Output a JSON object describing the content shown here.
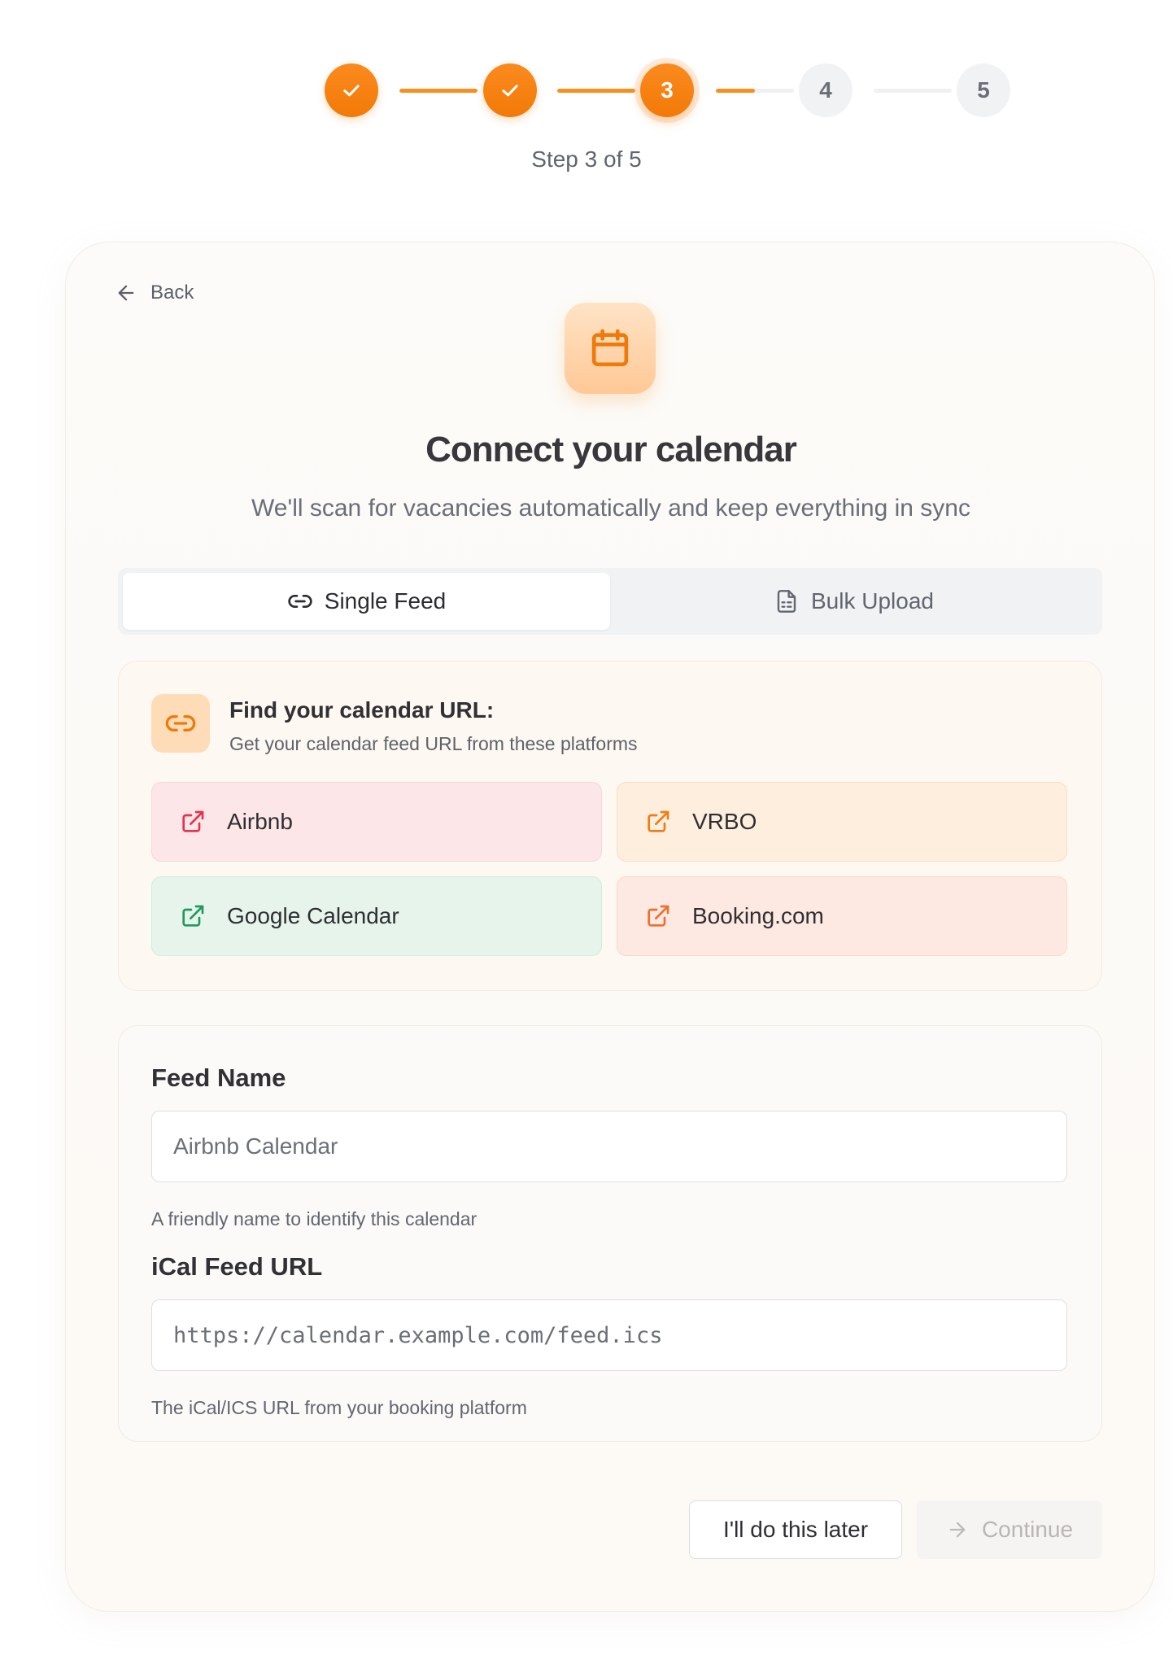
{
  "stepper": {
    "steps": [
      {
        "number": "1",
        "state": "done",
        "icon": "check-icon"
      },
      {
        "number": "2",
        "state": "done",
        "icon": "check-icon"
      },
      {
        "number": "3",
        "state": "active"
      },
      {
        "number": "4",
        "state": "todo"
      },
      {
        "number": "5",
        "state": "todo"
      }
    ],
    "connector_progress": [
      1.0,
      1.0,
      0.5,
      0.0
    ],
    "caption": "Step 3 of 5"
  },
  "nav": {
    "back_label": "Back",
    "back_icon": "arrow-left-icon"
  },
  "hero": {
    "icon": "calendar-icon",
    "title": "Connect your calendar",
    "subtitle": "We'll scan for vacancies automatically and keep everything in sync"
  },
  "tabs": [
    {
      "label": "Single Feed",
      "icon": "link-icon",
      "selected": true
    },
    {
      "label": "Bulk Upload",
      "icon": "file-spreadsheet-icon",
      "selected": false
    }
  ],
  "find_url": {
    "icon": "link-icon",
    "title": "Find your calendar URL:",
    "subtitle": "Get your calendar feed URL from these platforms",
    "platforms": [
      {
        "label": "Airbnb",
        "icon": "external-link-icon",
        "bg": "#fde6e8",
        "icon_color": "#e0344f"
      },
      {
        "label": "VRBO",
        "icon": "external-link-icon",
        "bg": "#fdeedd",
        "icon_color": "#ef7d16"
      },
      {
        "label": "Google Calendar",
        "icon": "external-link-icon",
        "bg": "#e6f4ec",
        "icon_color": "#1f9a5c"
      },
      {
        "label": "Booking.com",
        "icon": "external-link-icon",
        "bg": "#fde9e2",
        "icon_color": "#ee6f2b"
      }
    ]
  },
  "form": {
    "feed_name": {
      "label": "Feed Name",
      "placeholder": "Airbnb Calendar",
      "value": "",
      "help": "A friendly name to identify this calendar"
    },
    "ical_url": {
      "label": "iCal Feed URL",
      "placeholder": "https://calendar.example.com/feed.ics",
      "value": "",
      "help": "The iCal/ICS URL from your booking platform"
    }
  },
  "actions": {
    "later_label": "I'll do this later",
    "continue_label": "Continue",
    "continue_icon": "arrow-right-icon",
    "continue_disabled": true
  },
  "colors": {
    "accent": "#f7901f",
    "accent_dark": "#f27a07",
    "muted_step": "#f1f2f4"
  }
}
